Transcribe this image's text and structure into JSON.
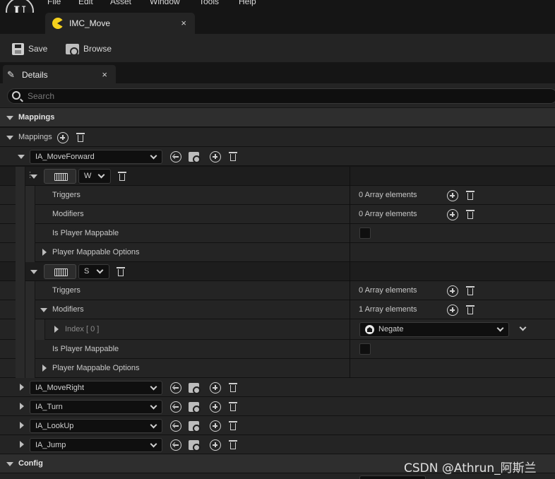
{
  "menu": {
    "items": [
      "File",
      "Edit",
      "Asset",
      "Window",
      "Tools",
      "Help"
    ]
  },
  "logo_text": "U",
  "asset_tab": {
    "label": "IMC_Move",
    "close": "×"
  },
  "toolbar": {
    "save_label": "Save",
    "browse_label": "Browse"
  },
  "panel": {
    "tab_label": "Details",
    "tab_close": "×",
    "search_placeholder": "Search"
  },
  "sections": {
    "mappings_category": "Mappings",
    "mappings_property": "Mappings",
    "config_category": "Config"
  },
  "mappings": [
    {
      "action": "IA_MoveForward",
      "expanded": true
    },
    {
      "action": "IA_MoveRight",
      "expanded": false
    },
    {
      "action": "IA_Turn",
      "expanded": false
    },
    {
      "action": "IA_LookUp",
      "expanded": false
    },
    {
      "action": "IA_Jump",
      "expanded": false
    }
  ],
  "key_mappings": [
    {
      "key": "W",
      "triggers_label": "Triggers",
      "triggers_value": "0 Array elements",
      "modifiers_label": "Modifiers",
      "modifiers_value": "0 Array elements",
      "mappable_label": "Is Player Mappable",
      "options_label": "Player Mappable Options"
    },
    {
      "key": "S",
      "triggers_label": "Triggers",
      "triggers_value": "0 Array elements",
      "modifiers_label": "Modifiers",
      "modifiers_value": "1 Array elements",
      "index_label": "Index [ 0 ]",
      "index_value": "Negate",
      "mappable_label": "Is Player Mappable",
      "options_label": "Player Mappable Options"
    }
  ],
  "watermark": "CSDN @Athrun_阿斯兰"
}
